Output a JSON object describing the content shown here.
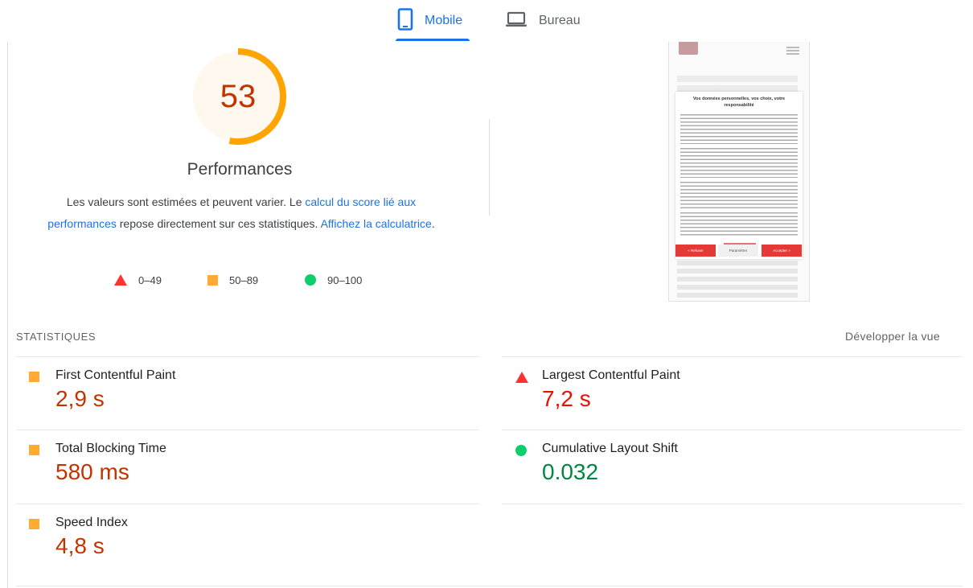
{
  "tabs": [
    {
      "label": "Mobile",
      "icon": "smartphone-icon",
      "selected": true
    },
    {
      "label": "Bureau",
      "icon": "laptop-icon",
      "selected": false
    }
  ],
  "score": {
    "value": 53,
    "fraction": 0.53,
    "title": "Performances",
    "color": "#ffa400",
    "text_color": "#c33300"
  },
  "description": {
    "text1": "Les valeurs sont estimées et peuvent varier. Le ",
    "link1": "calcul du score lié aux performances",
    "text2": " repose directement sur ces statistiques. ",
    "link2": "Affichez la calculatrice",
    "text3": "."
  },
  "legend": [
    {
      "shape": "triangle",
      "range": "0–49",
      "color": "#ff3333"
    },
    {
      "shape": "square",
      "range": "50–89",
      "color": "#ffaa33"
    },
    {
      "shape": "circle",
      "range": "90–100",
      "color": "#0cce6b"
    }
  ],
  "screenshot": {
    "dialog_title": "Vos données personnelles, vos choix, votre responsabilité",
    "buttons": [
      "« Refuser",
      "Paramétrer",
      "Accepter »"
    ]
  },
  "stats": {
    "heading": "STATISTIQUES",
    "expand_label": "Développer la vue",
    "metrics": [
      {
        "name": "First Contentful Paint",
        "value": "2,9 s",
        "status": "average"
      },
      {
        "name": "Largest Contentful Paint",
        "value": "7,2 s",
        "status": "fail"
      },
      {
        "name": "Total Blocking Time",
        "value": "580 ms",
        "status": "average"
      },
      {
        "name": "Cumulative Layout Shift",
        "value": "0.032",
        "status": "pass"
      },
      {
        "name": "Speed Index",
        "value": "4,8 s",
        "status": "average"
      }
    ]
  }
}
